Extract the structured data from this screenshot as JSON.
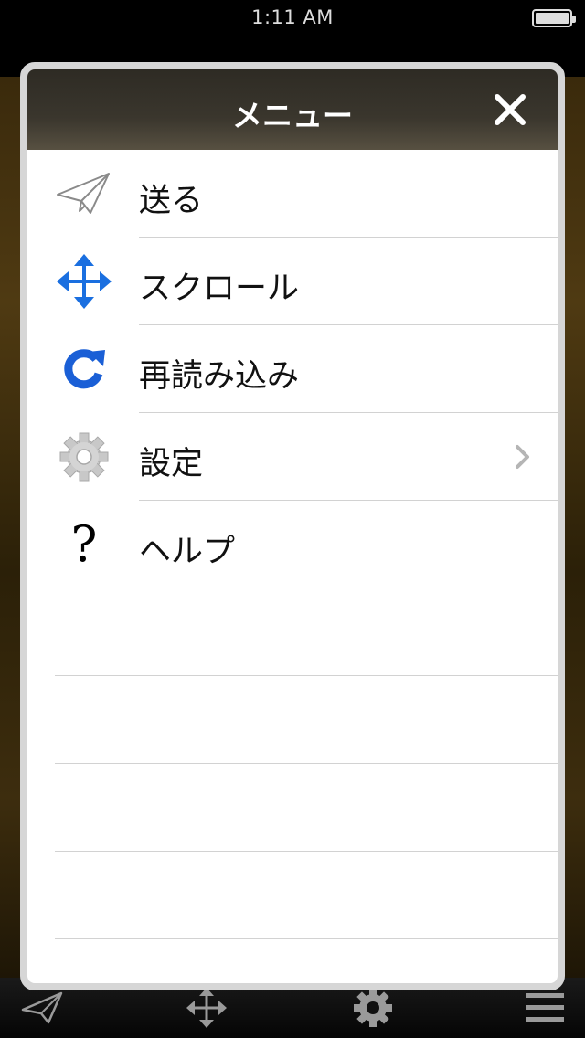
{
  "status_bar": {
    "time": "1:11 AM"
  },
  "menu": {
    "title": "メニュー",
    "items": [
      {
        "label": "送る",
        "icon": "paper-plane-icon"
      },
      {
        "label": "スクロール",
        "icon": "move-arrows-icon"
      },
      {
        "label": "再読み込み",
        "icon": "reload-icon"
      },
      {
        "label": "設定",
        "icon": "gear-icon",
        "has_chevron": true
      },
      {
        "label": "ヘルプ",
        "icon": "question-mark-icon"
      }
    ],
    "question_glyph": "?"
  },
  "toolbar": {
    "items": [
      "paper-plane-icon",
      "move-arrows-icon",
      "gear-icon",
      "hamburger-icon"
    ]
  },
  "colors": {
    "header": "#3a362d",
    "accent_blue": "#1a6fe0",
    "divider": "#d2d2d2"
  }
}
